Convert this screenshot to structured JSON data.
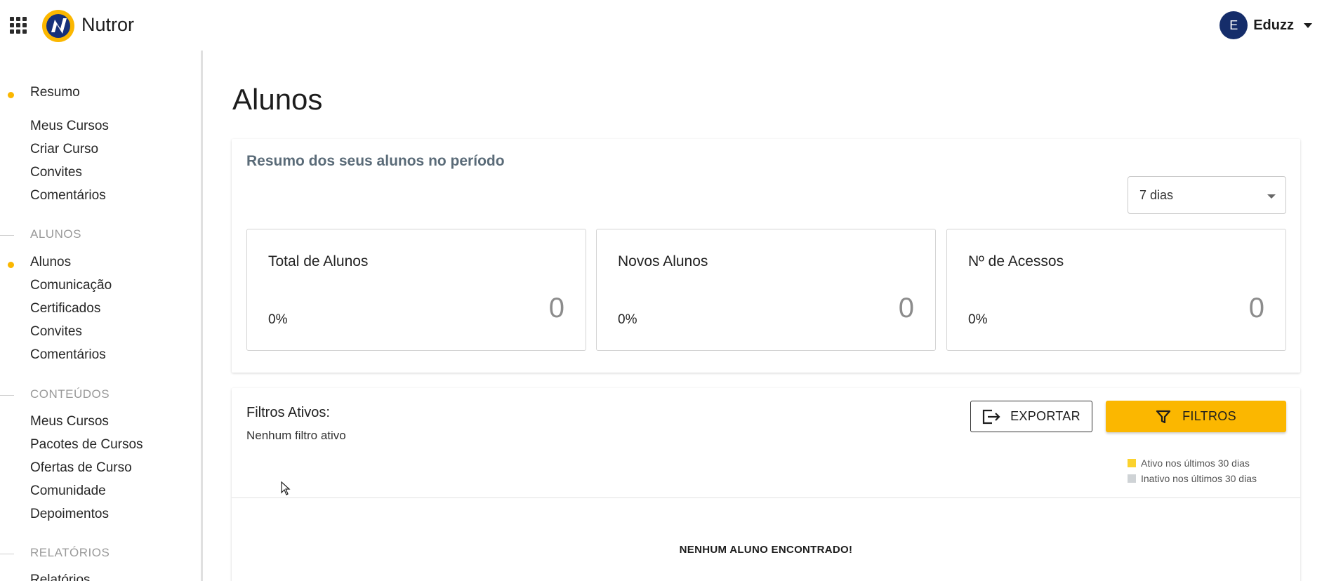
{
  "header": {
    "brand": "Nutror",
    "user": {
      "initial": "E",
      "name": "Eduzz"
    }
  },
  "sidebar": {
    "group_items": [
      {
        "label": "Resumo",
        "active": true
      },
      {
        "label": "Meus Cursos"
      },
      {
        "label": "Criar Curso"
      },
      {
        "label": "Convites"
      },
      {
        "label": "Comentários"
      }
    ],
    "sections": [
      {
        "title": "ALUNOS",
        "items": [
          {
            "label": "Alunos",
            "active": true
          },
          {
            "label": "Comunicação"
          },
          {
            "label": "Certificados"
          },
          {
            "label": "Convites"
          },
          {
            "label": "Comentários"
          }
        ]
      },
      {
        "title": "CONTEÚDOS",
        "items": [
          {
            "label": "Meus Cursos"
          },
          {
            "label": "Pacotes de Cursos"
          },
          {
            "label": "Ofertas de Curso"
          },
          {
            "label": "Comunidade"
          },
          {
            "label": "Depoimentos"
          }
        ]
      },
      {
        "title": "RELATÓRIOS",
        "items": [
          {
            "label": "Relatórios"
          }
        ]
      }
    ]
  },
  "main": {
    "title": "Alunos",
    "summary": {
      "title": "Resumo dos seus alunos no período",
      "period": "7 dias",
      "metrics": [
        {
          "label": "Total de Alunos",
          "percent": "0%",
          "value": "0"
        },
        {
          "label": "Novos Alunos",
          "percent": "0%",
          "value": "0"
        },
        {
          "label": "Nº de Acessos",
          "percent": "0%",
          "value": "0"
        }
      ]
    },
    "students": {
      "filters_label": "Filtros Ativos:",
      "filters_none": "Nenhum filtro ativo",
      "export_label": "EXPORTAR",
      "filters_button": "FILTROS",
      "legend": [
        {
          "label": "Ativo nos últimos 30 dias",
          "color": "#fbd22e"
        },
        {
          "label": "Inativo nos últimos 30 dias",
          "color": "#cfd3d6"
        }
      ],
      "empty_message": "NENHUM ALUNO ENCONTRADO!"
    }
  },
  "colors": {
    "accent": "#fbb700",
    "avatar_bg": "#152d6a",
    "summary_title": "#5a6b78"
  }
}
